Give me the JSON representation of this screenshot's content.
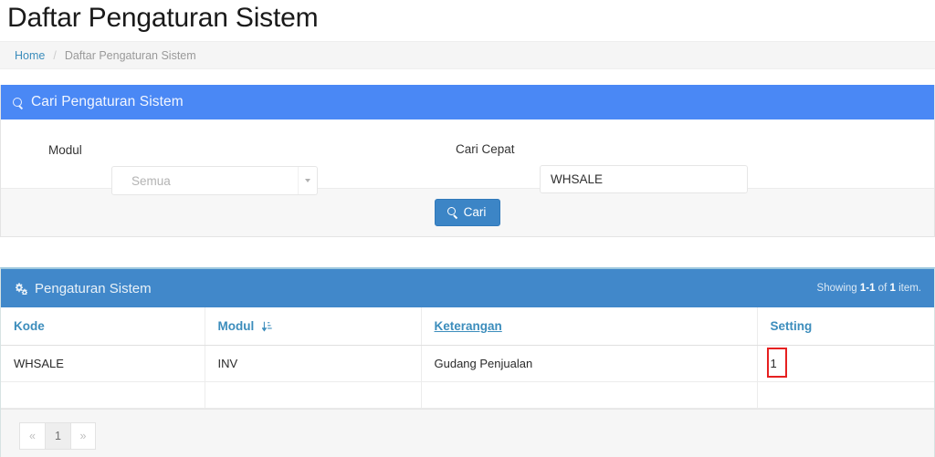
{
  "page_title": "Daftar Pengaturan Sistem",
  "breadcrumb": {
    "home": "Home",
    "separator": "/",
    "current": "Daftar Pengaturan Sistem"
  },
  "search_panel": {
    "header_title": "Cari Pengaturan Sistem",
    "header_icon": "search-icon",
    "header_bg": "#4a88f5",
    "modul_label": "Modul",
    "modul_value": "Semua",
    "modul_placeholder": "Semua",
    "cari_cepat_label": "Cari Cepat",
    "cari_cepat_value": "WHSALE",
    "cari_cepat_placeholder": "",
    "submit_label": "Cari",
    "submit_icon": "search-icon",
    "submit_bg": "#3c85c6"
  },
  "result_panel": {
    "header_title": "Pengaturan Sistem",
    "header_icon": "cogs-icon",
    "header_bg": "#4188ca",
    "showing_prefix": "Showing ",
    "showing_range": "1-1",
    "showing_middle": " of ",
    "showing_total": "1",
    "showing_suffix": " item.",
    "columns": [
      {
        "label": "Kode",
        "sortable": true,
        "sorted": false,
        "hovered": false
      },
      {
        "label": "Modul",
        "sortable": true,
        "sorted": true,
        "sort_icon": "sort-amount-asc-icon",
        "hovered": false
      },
      {
        "label": "Keterangan",
        "sortable": true,
        "sorted": false,
        "hovered": true
      },
      {
        "label": "Setting",
        "sortable": true,
        "sorted": false,
        "hovered": false
      }
    ],
    "rows": [
      {
        "kode": "WHSALE",
        "modul": "INV",
        "keterangan": "Gudang Penjualan",
        "setting": "1",
        "setting_highlighted": true
      }
    ],
    "highlight_color": "#e62020",
    "pagination": {
      "prev_label": "«",
      "pages": [
        "1"
      ],
      "active_page": "1",
      "next_label": "»"
    }
  }
}
